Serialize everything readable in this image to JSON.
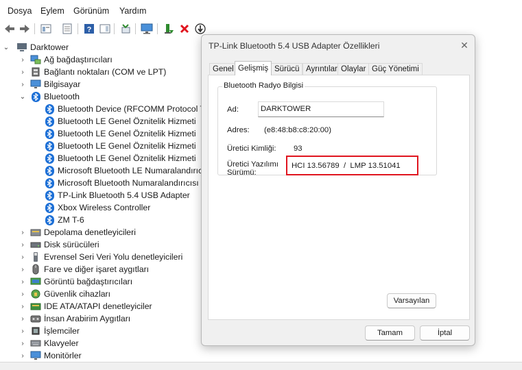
{
  "menu": [
    "Dosya",
    "Eylem",
    "Görünüm",
    "Yardım"
  ],
  "toolbar": {
    "icons": [
      "back-arrow-icon",
      "forward-arrow-icon",
      "properties-icon",
      "properties-sheet-icon",
      "help-icon",
      "action-pane-icon",
      "scan-hardware-icon",
      "monitor-icon",
      "update-driver-icon",
      "uninstall-icon",
      "disable-icon"
    ],
    "accent_red": "#e0141e",
    "accent_green": "#2e8b2e"
  },
  "tree": {
    "root": "Darktower",
    "categories_before": [
      {
        "label": "Ağ bağdaştırıcıları",
        "icon": "network-adapter-icon"
      },
      {
        "label": "Bağlantı noktaları (COM ve LPT)",
        "icon": "port-icon"
      },
      {
        "label": "Bilgisayar",
        "icon": "computer-icon"
      }
    ],
    "bluetooth": {
      "label": "Bluetooth",
      "children": [
        "Bluetooth Device (RFCOMM Protocol TDI)",
        "Bluetooth LE Genel Öznitelik Hizmeti",
        "Bluetooth LE Genel Öznitelik Hizmeti",
        "Bluetooth LE Genel Öznitelik Hizmeti",
        "Bluetooth LE Genel Öznitelik Hizmeti",
        "Microsoft Bluetooth LE Numaralandırıcısı",
        "Microsoft Bluetooth Numaralandırıcısı",
        "TP-Link Bluetooth 5.4 USB Adapter",
        "Xbox Wireless Controller",
        "ZM T-6"
      ]
    },
    "categories_after": [
      {
        "label": "Depolama denetleyicileri",
        "icon": "storage-controller-icon"
      },
      {
        "label": "Disk sürücüleri",
        "icon": "disk-drive-icon"
      },
      {
        "label": "Evrensel Seri Veri Yolu denetleyicileri",
        "icon": "usb-controller-icon"
      },
      {
        "label": "Fare ve diğer işaret aygıtları",
        "icon": "mouse-icon"
      },
      {
        "label": "Görüntü bağdaştırıcıları",
        "icon": "display-adapter-icon"
      },
      {
        "label": "Güvenlik cihazları",
        "icon": "security-device-icon"
      },
      {
        "label": "IDE ATA/ATAPI denetleyiciler",
        "icon": "ide-controller-icon"
      },
      {
        "label": "İnsan Arabirim Aygıtları",
        "icon": "hid-icon"
      },
      {
        "label": "İşlemciler",
        "icon": "processor-icon"
      },
      {
        "label": "Klavyeler",
        "icon": "keyboard-icon"
      },
      {
        "label": "Monitörler",
        "icon": "monitor-icon"
      }
    ]
  },
  "dialog": {
    "title": "TP-Link Bluetooth 5.4 USB Adapter Özellikleri",
    "tabs": [
      "Genel",
      "Gelişmiş",
      "Sürücü",
      "Ayrıntılar",
      "Olaylar",
      "Güç Yönetimi"
    ],
    "active_tab": "Gelişmiş",
    "group_title": "Bluetooth Radyo Bilgisi",
    "name_label": "Ad:",
    "name_value": "DARKTOWER",
    "address_label": "Adres:",
    "address_value": "(e8:48:b8:c8:20:00)",
    "manufacturer_label": "Üretici Kimliği:",
    "manufacturer_value": "93",
    "firmware_label_1": "Üretici Yazılımı",
    "firmware_label_2": "Sürümü:",
    "firmware_value": "HCI 13.56789  /  LMP 13.51041",
    "defaults_button": "Varsayılan",
    "ok_button": "Tamam",
    "cancel_button": "İptal"
  }
}
